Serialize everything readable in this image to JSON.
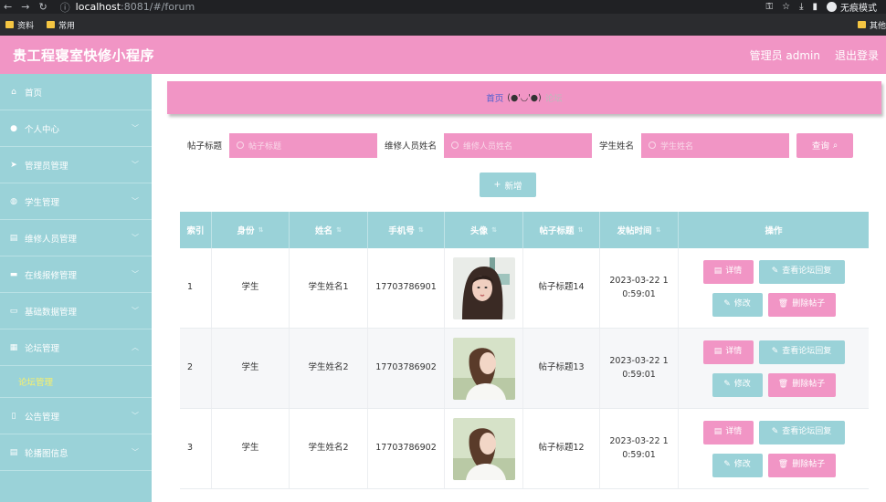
{
  "browser": {
    "url_host": "localhost",
    "url_rest": ":8081/#/forum",
    "incognito_label": "无痕模式",
    "bookmarks": [
      "资料",
      "常用"
    ],
    "bookmark_right": "其他"
  },
  "header": {
    "title": "贵工程寝室快修小程序",
    "user_label": "管理员 admin",
    "logout_label": "退出登录"
  },
  "sidebar": {
    "items": [
      {
        "label": "首页",
        "icon": "home-icon"
      },
      {
        "label": "个人中心",
        "icon": "user-icon"
      },
      {
        "label": "管理员管理",
        "icon": "send-icon"
      },
      {
        "label": "学生管理",
        "icon": "globe-icon"
      },
      {
        "label": "维修人员管理",
        "icon": "clipboard-icon"
      },
      {
        "label": "在线报修管理",
        "icon": "chat-icon"
      },
      {
        "label": "基础数据管理",
        "icon": "monitor-icon"
      },
      {
        "label": "论坛管理",
        "icon": "grid-icon"
      }
    ],
    "sub_item": "论坛管理",
    "items_after": [
      {
        "label": "公告管理",
        "icon": "phone-icon"
      },
      {
        "label": "轮播图信息",
        "icon": "doc-icon"
      }
    ]
  },
  "breadcrumb": {
    "home": "首页",
    "face": "(●'◡'●)",
    "current": "论坛"
  },
  "search": {
    "fields": [
      {
        "label": "帖子标题",
        "placeholder": "帖子标题"
      },
      {
        "label": "维修人员姓名",
        "placeholder": "维修人员姓名"
      },
      {
        "label": "学生姓名",
        "placeholder": "学生姓名"
      }
    ],
    "query_label": "查询",
    "add_label": "新增"
  },
  "table": {
    "headers": [
      "索引",
      "身份",
      "姓名",
      "手机号",
      "头像",
      "帖子标题",
      "发帖时间",
      "操作"
    ],
    "rows": [
      {
        "index": "1",
        "identity": "学生",
        "name": "学生姓名1",
        "phone": "17703786901",
        "title": "帖子标题14",
        "time": "2023-03-22 1\n0:59:01"
      },
      {
        "index": "2",
        "identity": "学生",
        "name": "学生姓名2",
        "phone": "17703786902",
        "title": "帖子标题13",
        "time": "2023-03-22 1\n0:59:01"
      },
      {
        "index": "3",
        "identity": "学生",
        "name": "学生姓名2",
        "phone": "17703786902",
        "title": "帖子标题12",
        "time": "2023-03-22 1\n0:59:01"
      }
    ],
    "actions": {
      "detail": "详情",
      "view_reply": "查看论坛回复",
      "edit": "修改",
      "delete": "删除帖子"
    }
  },
  "colors": {
    "pink": "#f195c5",
    "teal": "#9ad2d8",
    "active_sub": "#f8f06a"
  }
}
